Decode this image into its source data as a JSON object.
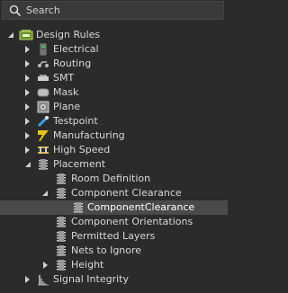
{
  "search": {
    "placeholder": "Search"
  },
  "tree": {
    "root": {
      "label": "Design Rules",
      "icon": "design-rules-icon"
    },
    "items": [
      {
        "label": "Electrical",
        "icon": "electrical-icon"
      },
      {
        "label": "Routing",
        "icon": "routing-icon"
      },
      {
        "label": "SMT",
        "icon": "smt-icon"
      },
      {
        "label": "Mask",
        "icon": "mask-icon"
      },
      {
        "label": "Plane",
        "icon": "plane-icon"
      },
      {
        "label": "Testpoint",
        "icon": "testpoint-icon"
      },
      {
        "label": "Manufacturing",
        "icon": "manufacturing-icon"
      },
      {
        "label": "High Speed",
        "icon": "high-speed-icon"
      },
      {
        "label": "Placement",
        "icon": "placement-icon"
      },
      {
        "label": "Room Definition",
        "icon": "rule-icon"
      },
      {
        "label": "Component Clearance",
        "icon": "rule-icon"
      },
      {
        "label": "ComponentClearance",
        "icon": "rule-icon"
      },
      {
        "label": "Component Orientations",
        "icon": "rule-icon"
      },
      {
        "label": "Permitted Layers",
        "icon": "rule-icon"
      },
      {
        "label": "Nets to Ignore",
        "icon": "rule-icon"
      },
      {
        "label": "Height",
        "icon": "rule-icon"
      },
      {
        "label": "Signal Integrity",
        "icon": "signal-integrity-icon"
      }
    ]
  }
}
